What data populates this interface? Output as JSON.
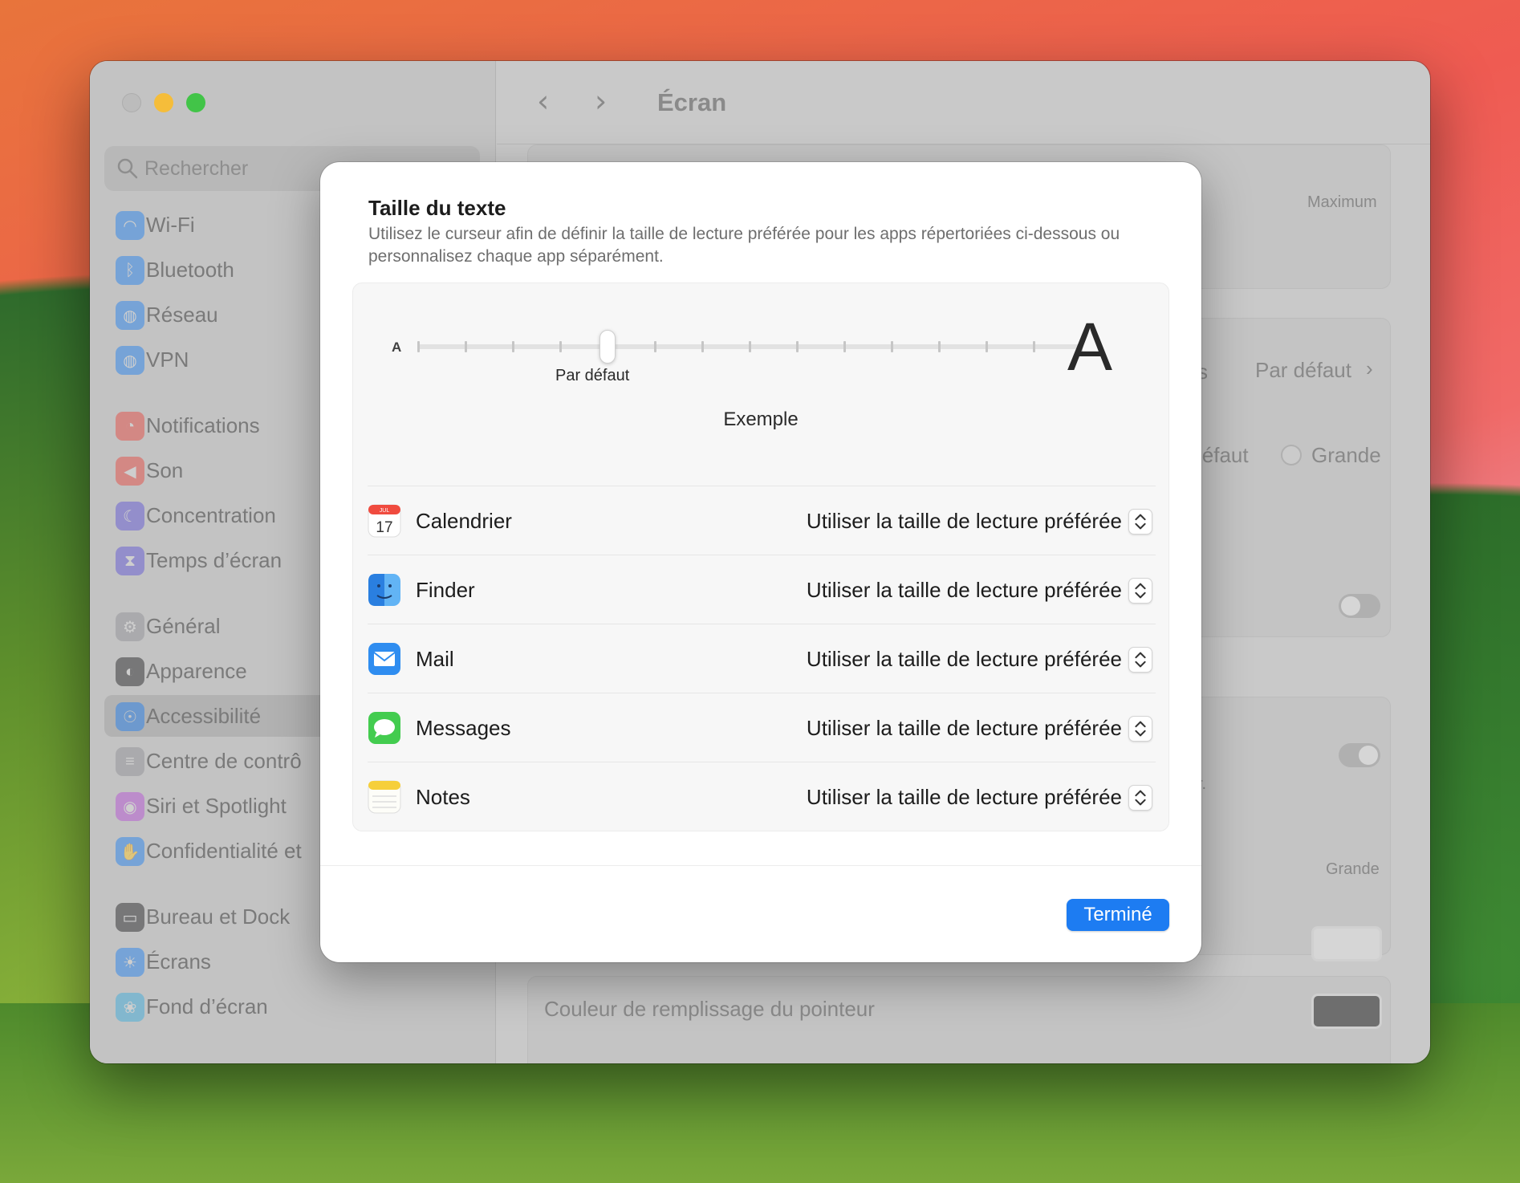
{
  "window": {
    "title": "Écran"
  },
  "sidebar": {
    "search_placeholder": "Rechercher",
    "items": [
      {
        "label": "Wi-Fi",
        "icon": "wifi-icon",
        "color": "#1a7df0"
      },
      {
        "label": "Bluetooth",
        "icon": "bluetooth-icon",
        "color": "#1a7df0"
      },
      {
        "label": "Réseau",
        "icon": "globe-icon",
        "color": "#1a7df0"
      },
      {
        "label": "VPN",
        "icon": "globe-icon",
        "color": "#1a7df0"
      },
      {
        "label": "Notifications",
        "icon": "bell-icon",
        "color": "#e8413a"
      },
      {
        "label": "Son",
        "icon": "speaker-icon",
        "color": "#e8413a"
      },
      {
        "label": "Concentration",
        "icon": "moon-icon",
        "color": "#5b4fd6"
      },
      {
        "label": "Temps d’écran",
        "icon": "hourglass-icon",
        "color": "#5b4fd6"
      },
      {
        "label": "Général",
        "icon": "gear-icon",
        "color": "#8e8e93"
      },
      {
        "label": "Apparence",
        "icon": "appearance-icon",
        "color": "#1c1c1e"
      },
      {
        "label": "Accessibilité",
        "icon": "accessibility-icon",
        "color": "#1a7df0"
      },
      {
        "label": "Centre de contrô",
        "icon": "control-center-icon",
        "color": "#8e8e93"
      },
      {
        "label": "Siri et Spotlight",
        "icon": "siri-icon",
        "color": "#b44ad6"
      },
      {
        "label": "Confidentialité et",
        "icon": "hand-icon",
        "color": "#1a7df0"
      },
      {
        "label": "Bureau et Dock",
        "icon": "dock-icon",
        "color": "#1c1c1e"
      },
      {
        "label": "Écrans",
        "icon": "sun-icon",
        "color": "#1a7df0"
      },
      {
        "label": "Fond d’écran",
        "icon": "flower-icon",
        "color": "#34aadc"
      }
    ],
    "active_index": 10
  },
  "background_pane": {
    "maximum_label": "Maximum",
    "par_defaut_link": "Par défaut",
    "partial_s": "s",
    "defaut_partial": "léfaut",
    "grande_radio": "Grande",
    "grande_label": "Grande",
    "partial_r": "r.",
    "pointer_fill_label": "Couleur de remplissage du pointeur",
    "pointer_fill_color": "#6e6e6e"
  },
  "modal": {
    "title": "Taille du texte",
    "description": "Utilisez le curseur afin de définir la taille de lecture préférée pour les apps répertoriées ci-dessous ou personnalisez chaque app séparément.",
    "slider": {
      "small_label": "A",
      "large_label": "A",
      "value_label": "Par défaut",
      "position_step": 4,
      "steps": 15
    },
    "example_label": "Exemple",
    "apps": [
      {
        "name": "Calendrier",
        "icon": "calendar-icon",
        "value": "Utiliser la taille de lecture préférée",
        "calendar_month": "JUL",
        "calendar_day": "17"
      },
      {
        "name": "Finder",
        "icon": "finder-icon",
        "value": "Utiliser la taille de lecture préférée"
      },
      {
        "name": "Mail",
        "icon": "mail-icon",
        "value": "Utiliser la taille de lecture préférée"
      },
      {
        "name": "Messages",
        "icon": "messages-icon",
        "value": "Utiliser la taille de lecture préférée"
      },
      {
        "name": "Notes",
        "icon": "notes-icon",
        "value": "Utiliser la taille de lecture préférée"
      }
    ],
    "done_label": "Terminé",
    "accent_color": "#1d7cf2"
  }
}
